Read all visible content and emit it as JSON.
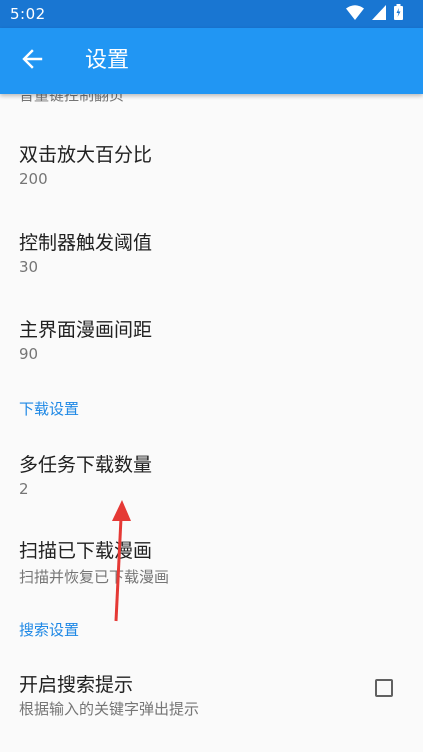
{
  "status_bar": {
    "time": "5:02"
  },
  "app_bar": {
    "title": "设置"
  },
  "partial_item": {
    "summary": "音量键控制翻页"
  },
  "items": [
    {
      "title": "双击放大百分比",
      "summary": "200"
    },
    {
      "title": "控制器触发阈值",
      "summary": "30"
    },
    {
      "title": "主界面漫画间距",
      "summary": "90"
    }
  ],
  "download_section": {
    "header": "下载设置",
    "items": [
      {
        "title": "多任务下载数量",
        "summary": "2"
      },
      {
        "title": "扫描已下载漫画",
        "summary": "扫描并恢复已下载漫画"
      }
    ]
  },
  "search_section": {
    "header": "搜索设置",
    "items": [
      {
        "title": "开启搜索提示",
        "summary": "根据输入的关键字弹出提示",
        "checked": false
      }
    ]
  },
  "colors": {
    "status_bar": "#1976d2",
    "app_bar": "#2196f3",
    "accent": "#1e88e5",
    "annotation_arrow": "#e53935"
  }
}
